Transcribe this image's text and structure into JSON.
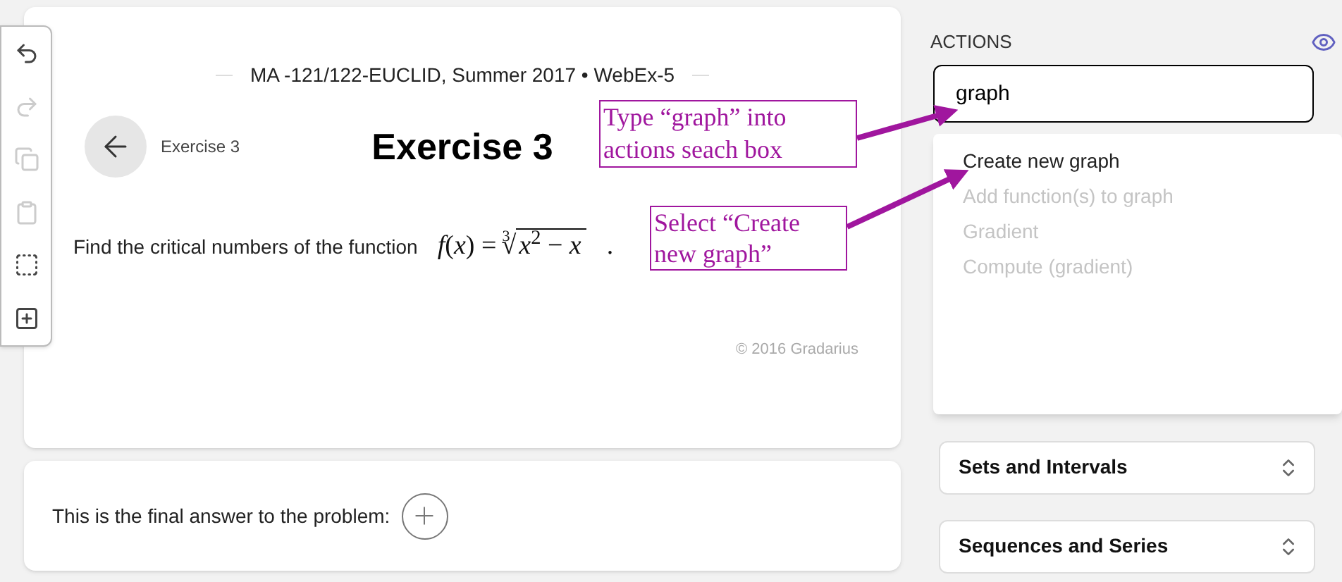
{
  "toolbar": [
    {
      "kind": "undo",
      "disabled": false
    },
    {
      "kind": "redo",
      "disabled": true
    },
    {
      "kind": "copy",
      "disabled": true
    },
    {
      "kind": "paste",
      "disabled": true
    },
    {
      "kind": "select",
      "disabled": false
    },
    {
      "kind": "add",
      "disabled": false
    }
  ],
  "exercise": {
    "course": "MA -121/122-EUCLID, Summer 2017 • WebEx-5",
    "breadcrumb": "Exercise 3",
    "title": "Exercise 3",
    "problem": "Find the critical numbers of the function",
    "formula": {
      "lhs": "*f*(*x*) =",
      "root_sign": "√",
      "root_index": "3",
      "radicand": "*x*$^{2}$ − *x*",
      "end": "."
    },
    "copyright": "© 2016 Gradarius"
  },
  "answer": {
    "text": "This is the final answer to the problem:"
  },
  "actions": {
    "title": "ACTIONS",
    "search": {
      "value": "graph"
    },
    "results": [
      {
        "label": "Create new graph",
        "disabled": false
      },
      {
        "label": "Add function(s) to graph",
        "disabled": true
      },
      {
        "label": "Gradient",
        "disabled": true
      },
      {
        "label": "Compute (gradient)",
        "disabled": true
      }
    ],
    "panels": [
      {
        "label": "Sets and Intervals",
        "expanded": false
      },
      {
        "label": "Sequences and Series",
        "expanded": false
      }
    ]
  },
  "annotations": [
    {
      "text": "Type “graph” into actions seach box"
    },
    {
      "text": "Select “Create new graph”"
    }
  ]
}
